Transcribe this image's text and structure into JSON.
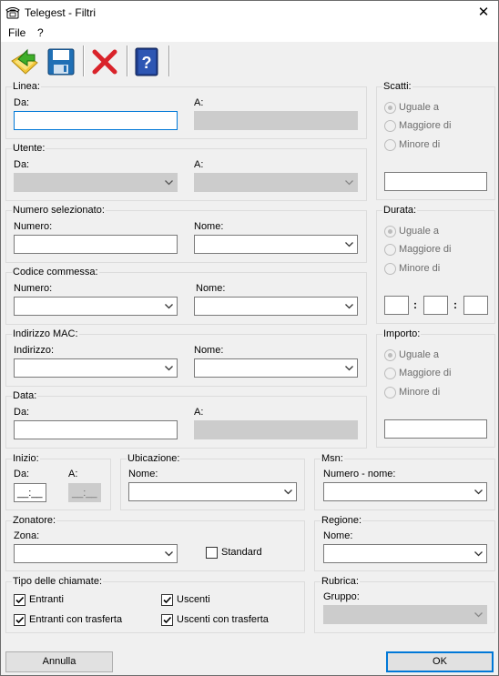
{
  "window": {
    "title": "Telegest - Filtri",
    "close_icon": "close-icon"
  },
  "menu": [
    "File",
    "?"
  ],
  "toolbar": {
    "icons": [
      "apply-filter-icon",
      "save-icon",
      "delete-icon",
      "help-icon"
    ],
    "colors": {
      "folder": "#f3c73a",
      "arrow": "#3fae29",
      "disk": "#1f6fb5",
      "delete": "#d9232a",
      "help": "#1f3f8f"
    }
  },
  "linea": {
    "label": "Linea:",
    "da": "Da:",
    "a": "A:",
    "da_value": "",
    "a_value": ""
  },
  "utente": {
    "label": "Utente:",
    "da": "Da:",
    "a": "A:"
  },
  "numero_selezionato": {
    "label": "Numero selezionato:",
    "numero": "Numero:",
    "nome": "Nome:"
  },
  "codice_commessa": {
    "label": "Codice commessa:",
    "numero": "Numero:",
    "nome": "Nome:"
  },
  "indirizzo_mac": {
    "label": "Indirizzo MAC:",
    "indirizzo": "Indirizzo:",
    "nome": "Nome:"
  },
  "data": {
    "label": "Data:",
    "da": "Da:",
    "a": "A:"
  },
  "scatti": {
    "label": "Scatti:",
    "options": [
      "Uguale a",
      "Maggiore di",
      "Minore di"
    ],
    "selected": "Uguale a"
  },
  "durata": {
    "label": "Durata:",
    "options": [
      "Uguale a",
      "Maggiore di",
      "Minore di"
    ],
    "selected": "Uguale a",
    "sep": ":"
  },
  "importo": {
    "label": "Importo:",
    "options": [
      "Uguale a",
      "Maggiore di",
      "Minore di"
    ],
    "selected": "Uguale a"
  },
  "inizio": {
    "label": "Inizio:",
    "da": "Da:",
    "a": "A:",
    "da_value": "__:__",
    "a_value": "__:__"
  },
  "ubicazione": {
    "label": "Ubicazione:",
    "nome": "Nome:"
  },
  "msn": {
    "label": "Msn:",
    "numero_nome": "Numero - nome:"
  },
  "zonatore": {
    "label": "Zonatore:",
    "zona": "Zona:",
    "standard": "Standard",
    "standard_checked": false
  },
  "regione": {
    "label": "Regione:",
    "nome": "Nome:"
  },
  "tipo_chiamate": {
    "label": "Tipo delle chiamate:",
    "entranti": "Entranti",
    "uscenti": "Uscenti",
    "entranti_trasferta": "Entranti con trasferta",
    "uscenti_trasferta": "Uscenti con trasferta",
    "all_checked": true
  },
  "rubrica": {
    "label": "Rubrica:",
    "gruppo": "Gruppo:"
  },
  "buttons": {
    "annulla": "Annulla",
    "ok": "OK"
  }
}
